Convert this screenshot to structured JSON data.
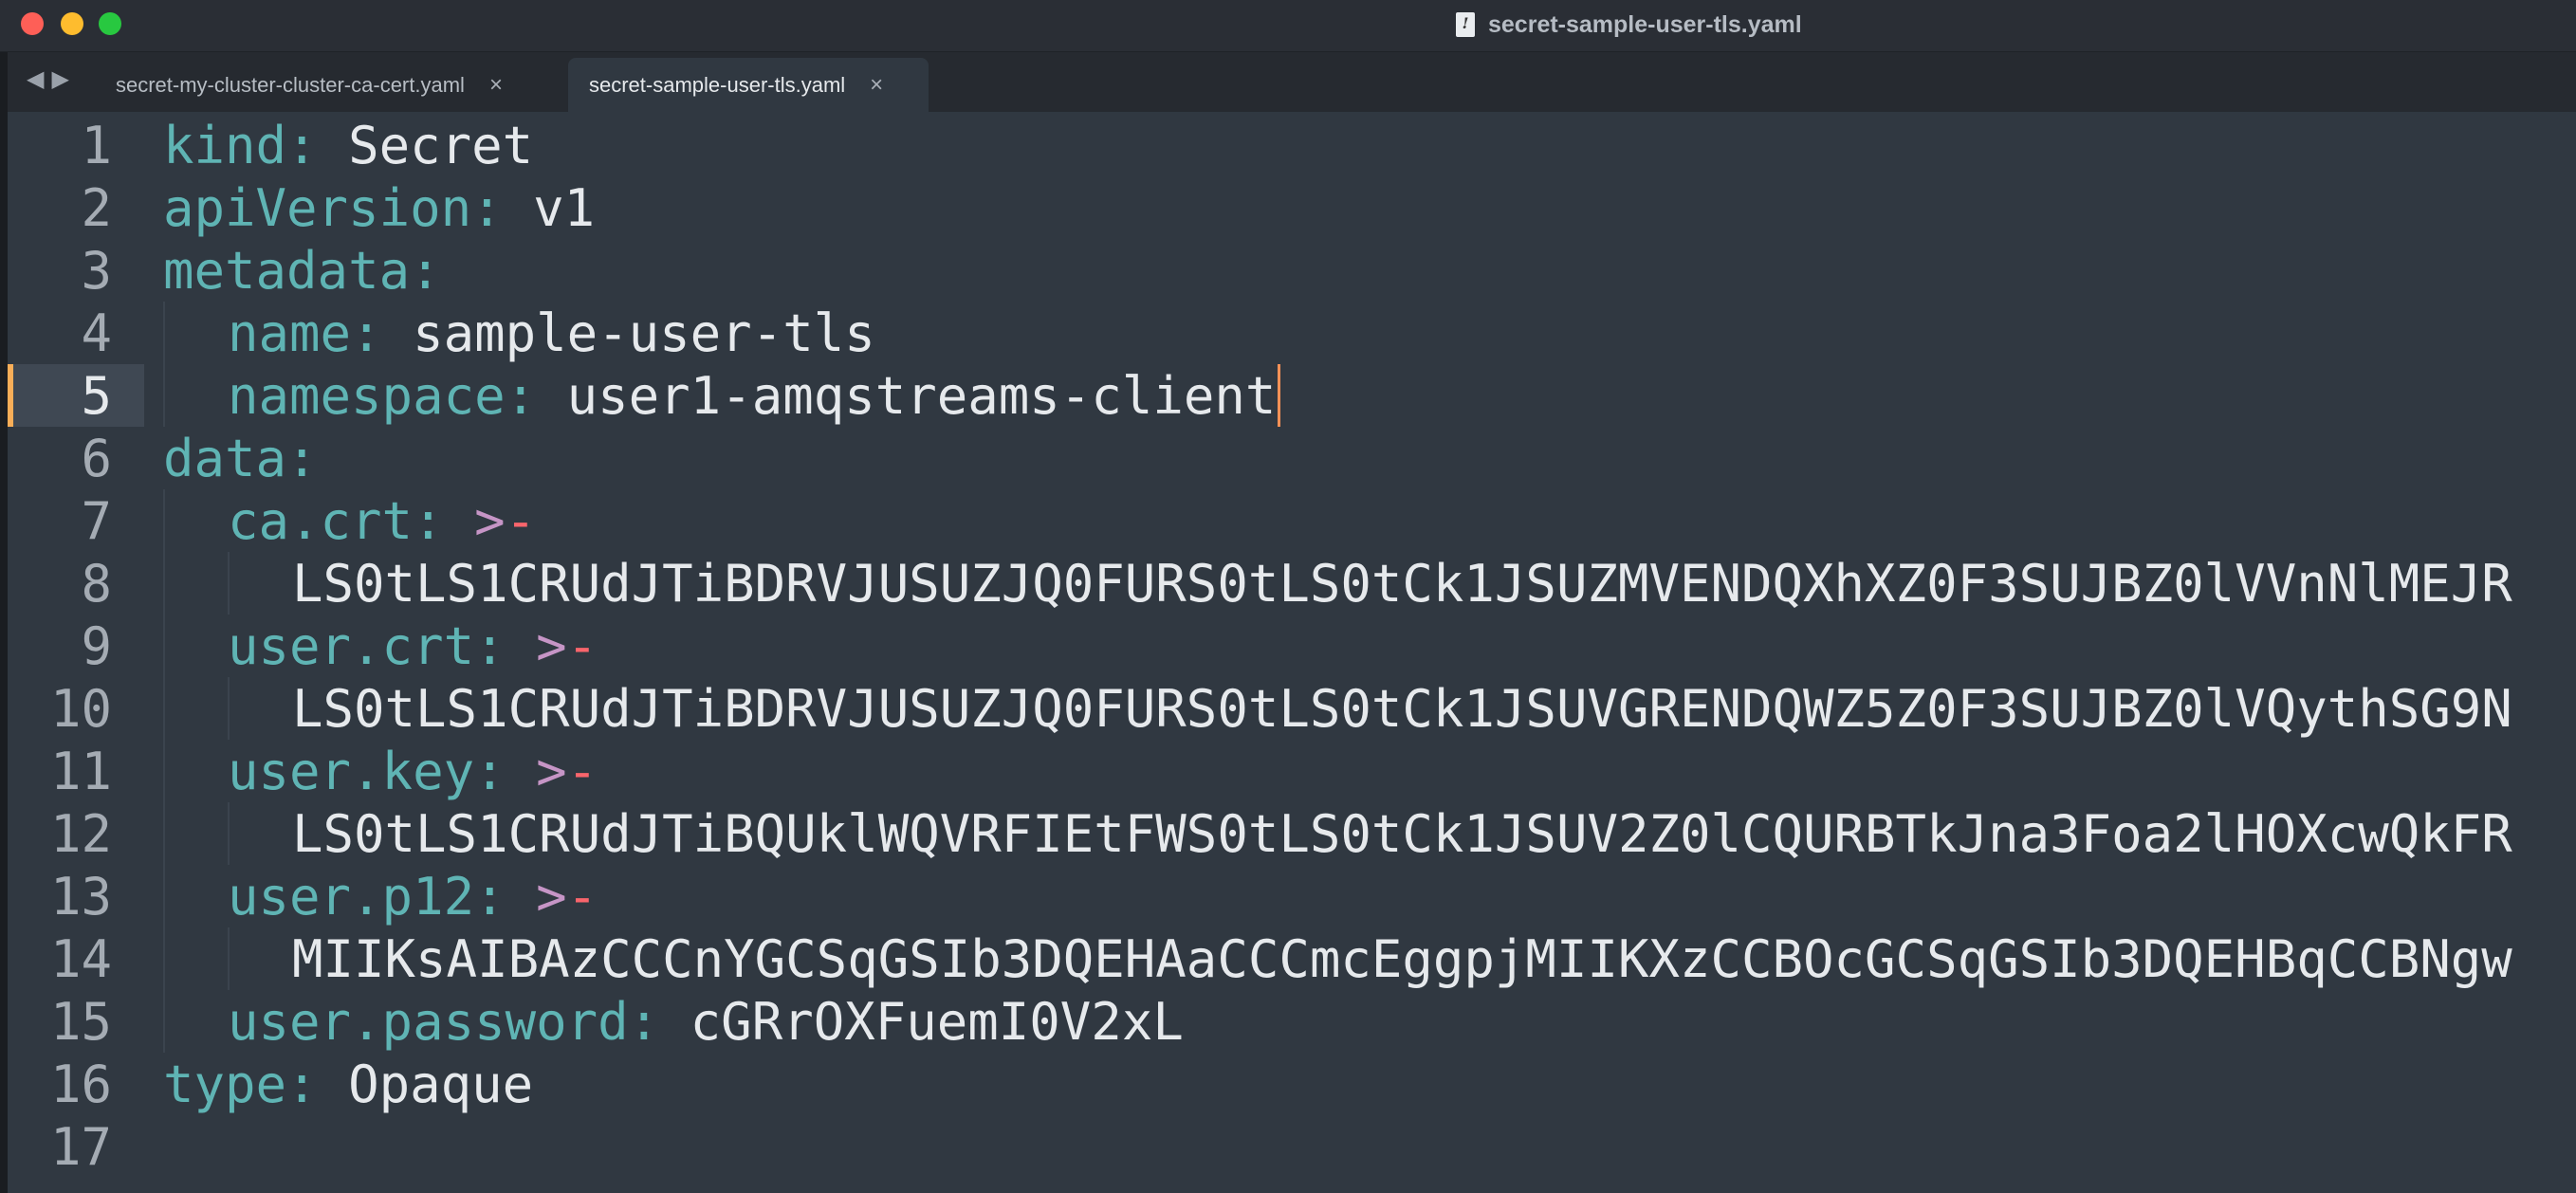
{
  "window": {
    "title": "secret-sample-user-tls.yaml"
  },
  "tabs": [
    {
      "label": "secret-my-cluster-cluster-ca-cert.yaml",
      "close": "×",
      "active": false
    },
    {
      "label": "secret-sample-user-tls.yaml",
      "close": "×",
      "active": true
    }
  ],
  "nav": {
    "back": "◀",
    "forward": "▶"
  },
  "editor": {
    "current_line": 5,
    "lines": [
      {
        "num": "1",
        "key": "kind",
        "sep": ": ",
        "value": "Secret"
      },
      {
        "num": "2",
        "key": "apiVersion",
        "sep": ": ",
        "value": "v1"
      },
      {
        "num": "3",
        "key": "metadata",
        "sep": ":",
        "value": ""
      },
      {
        "num": "4",
        "key": "name",
        "sep": ": ",
        "value": "sample-user-tls"
      },
      {
        "num": "5",
        "key": "namespace",
        "sep": ": ",
        "value": "user1-amqstreams-client"
      },
      {
        "num": "6",
        "key": "data",
        "sep": ":",
        "value": ""
      },
      {
        "num": "7",
        "key": "ca.crt",
        "sep": ": ",
        "block": ">",
        "dash": "-"
      },
      {
        "num": "8",
        "value": "LS0tLS1CRUdJTiBDRVJUSUZJQ0FURS0tLS0tCk1JSUZMVENDQXhXZ0F3SUJBZ0lVVnNlMEJR"
      },
      {
        "num": "9",
        "key": "user.crt",
        "sep": ": ",
        "block": ">",
        "dash": "-"
      },
      {
        "num": "10",
        "value": "LS0tLS1CRUdJTiBDRVJUSUZJQ0FURS0tLS0tCk1JSUVGRENDQWZ5Z0F3SUJBZ0lVQythSG9N"
      },
      {
        "num": "11",
        "key": "user.key",
        "sep": ": ",
        "block": ">",
        "dash": "-"
      },
      {
        "num": "12",
        "value": "LS0tLS1CRUdJTiBQUklWQVRFIEtFWS0tLS0tCk1JSUV2Z0lCQURBTkJna3Foa2lHOXcwQkFR"
      },
      {
        "num": "13",
        "key": "user.p12",
        "sep": ": ",
        "block": ">",
        "dash": "-"
      },
      {
        "num": "14",
        "value": "MIIKsAIBAzCCCnYGCSqGSIb3DQEHAaCCCmcEggpjMIIKXzCCBOcGCSqGSIb3DQEHBqCCBNgw"
      },
      {
        "num": "15",
        "key": "user.password",
        "sep": ": ",
        "value": "cGRrOXFuemI0V2xL"
      },
      {
        "num": "16",
        "key": "type",
        "sep": ": ",
        "value": "Opaque"
      },
      {
        "num": "17",
        "value": ""
      }
    ]
  }
}
